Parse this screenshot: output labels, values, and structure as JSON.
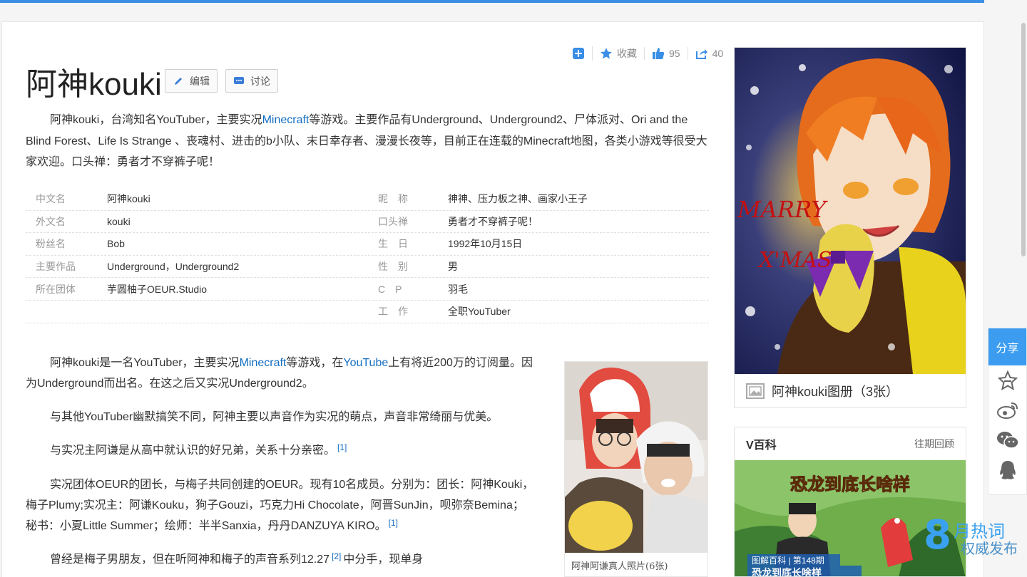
{
  "page": {
    "title": "阿神kouki",
    "edit_label": "编辑",
    "discuss_label": "讨论"
  },
  "actions": {
    "favorite_label": "收藏",
    "like_count": "95",
    "share_count": "40"
  },
  "intro": {
    "t1": "阿神kouki，台湾知名YouTuber，主要实况",
    "link1": "Minecraft",
    "t2": "等游戏。主要作品有Underground、Underground2、尸体派对、Ori and the Blind Forest、Life Is Strange 、丧魂村、进击的b小队、末日幸存者、漫漫长夜等，目前正在连载的Minecraft地图，各类小游戏等很受大家欢迎。口头禅：勇者才不穿裤子呢！"
  },
  "infobox": [
    {
      "k1": "中文名",
      "v1": "阿神kouki",
      "k2": "昵　称",
      "v2": "神神、压力板之神、画家小王子"
    },
    {
      "k1": "外文名",
      "v1": "kouki",
      "k2": "口头禅",
      "v2": "勇者才不穿裤子呢！"
    },
    {
      "k1": "粉丝名",
      "v1": "Bob",
      "k2": "生　日",
      "v2": "1992年10月15日"
    },
    {
      "k1": "主要作品",
      "v1": "Underground，Underground2",
      "k2": "性　别",
      "v2": "男"
    },
    {
      "k1": "所在团体",
      "v1": "芋圆柚子OEUR.Studio",
      "k2": "C　P",
      "v2": "羽毛"
    },
    {
      "k1": "",
      "v1": "",
      "k2": "工　作",
      "v2": "全职YouTuber"
    }
  ],
  "body": {
    "p1_a": "阿神kouki是一名YouTuber，主要实况",
    "p1_link1": "Minecraft",
    "p1_b": "等游戏，在",
    "p1_link2": "YouTube",
    "p1_c": "上有将近200万的订阅量。因",
    "p1_d": "为Underground而出名。在这之后又实况Underground2。",
    "p2": "与其他YouTuber幽默搞笑不同，阿神主要以声音作为实况的萌点，声音非常绮丽与优美。",
    "p3": "与实况主阿谦是从高中就认识的好兄弟，关系十分亲密。",
    "p3_ref": "[1]",
    "p4_a": "实况团体OEUR的团长，与梅子共同创建的OEUR。现有10名成员。分别为：团长：阿神Kouki，",
    "p4_b": "梅子Plumy;实况主：阿谦Kouku，狗子Gouzi，巧克力Hi Chocolate，阿晋SunJin，呗弥奈Bemina；",
    "p4_c": "秘书：小夏Little Summer；绘师：半半Sanxia，丹丹DANZUYA KIRO。",
    "p4_ref": "[1]",
    "p5_a": "曾经是梅子男朋友，但在听阿神和梅子的声音系列12.27",
    "p5_ref": "[2]",
    "p5_b": "中分手，现单身"
  },
  "photo": {
    "caption": "阿神阿谦真人照片(6张)"
  },
  "cover": {
    "painted_text_1": "MARRY",
    "painted_text_2": "X'MAS",
    "album_label": "阿神kouki图册（3张）"
  },
  "vbaike": {
    "title": "V百科",
    "more": "往期回顾",
    "banner_title": "恐龙到底长啥样",
    "banner_sub": "图解百科 | 第148期",
    "banner_sub2": "恐龙到底长啥样"
  },
  "share_rail": {
    "label": "分享"
  },
  "watermark": {
    "number": "8",
    "line1": "月热词",
    "line2": "权威发布"
  },
  "colors": {
    "accent": "#3a8ee6",
    "link": "#136ec2",
    "share_blue": "#3b9cf0"
  }
}
